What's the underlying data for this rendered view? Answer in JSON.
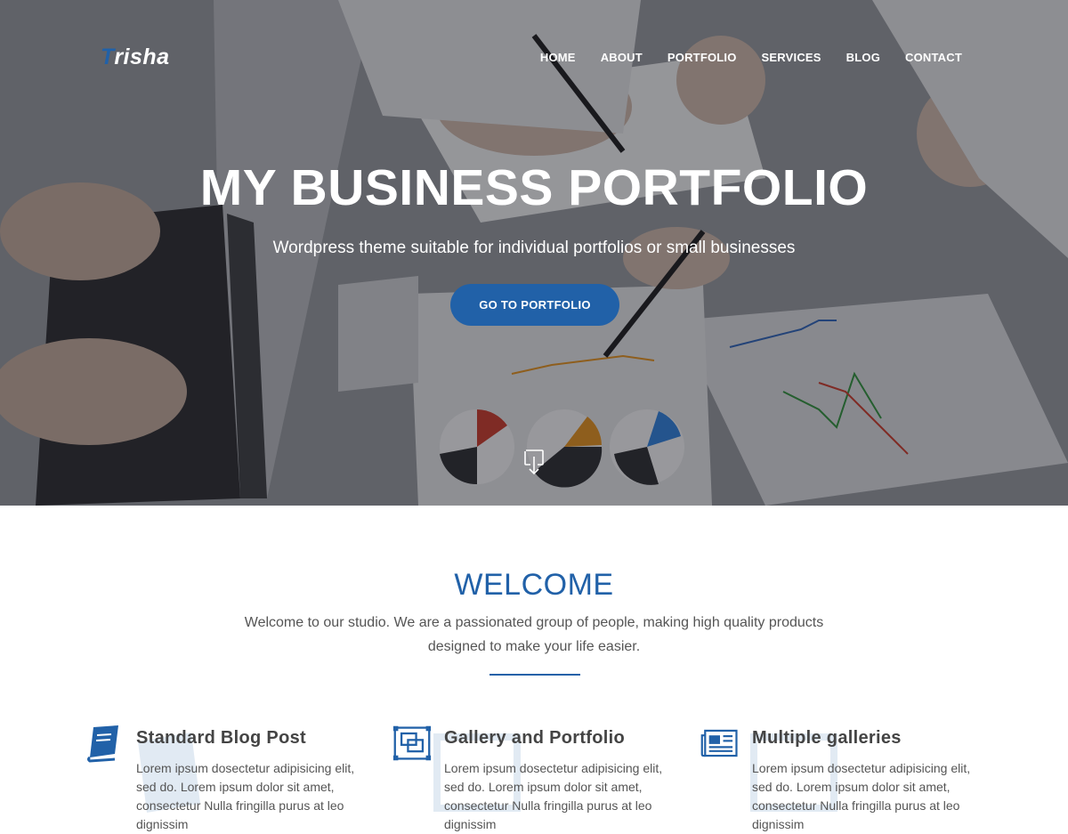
{
  "brand": {
    "logo_first_letter": "T",
    "logo_rest": "risha",
    "accent_color": "#2161a8"
  },
  "nav": {
    "items": [
      {
        "label": "HOME"
      },
      {
        "label": "ABOUT"
      },
      {
        "label": "PORTFOLIO"
      },
      {
        "label": "SERVICES"
      },
      {
        "label": "BLOG"
      },
      {
        "label": "CONTACT"
      }
    ]
  },
  "hero": {
    "title": "MY BUSINESS PORTFOLIO",
    "subtitle": "Wordpress theme suitable for individual portfolios or small businesses",
    "button_label": "GO TO PORTFOLIO",
    "scroll_icon": "scroll-down-icon"
  },
  "welcome": {
    "title": "WELCOME",
    "text": "Welcome to our studio. We are a passionated group of people, making high quality products designed to make your life easier."
  },
  "features": [
    {
      "icon": "book-icon",
      "title": "Standard Blog Post",
      "text": "Lorem ipsum dosectetur adipisicing elit, sed do. Lorem ipsum dolor sit amet, consectetur Nulla fringilla purus at leo dignissim"
    },
    {
      "icon": "gallery-icon",
      "title": "Gallery and Portfolio",
      "text": "Lorem ipsum dosectetur adipisicing elit, sed do. Lorem ipsum dolor sit amet, consectetur Nulla fringilla purus at leo dignissim"
    },
    {
      "icon": "newspaper-icon",
      "title": "Multiple galleries",
      "text": "Lorem ipsum dosectetur adipisicing elit, sed do. Lorem ipsum dolor sit amet, consectetur Nulla fringilla purus at leo dignissim"
    }
  ]
}
